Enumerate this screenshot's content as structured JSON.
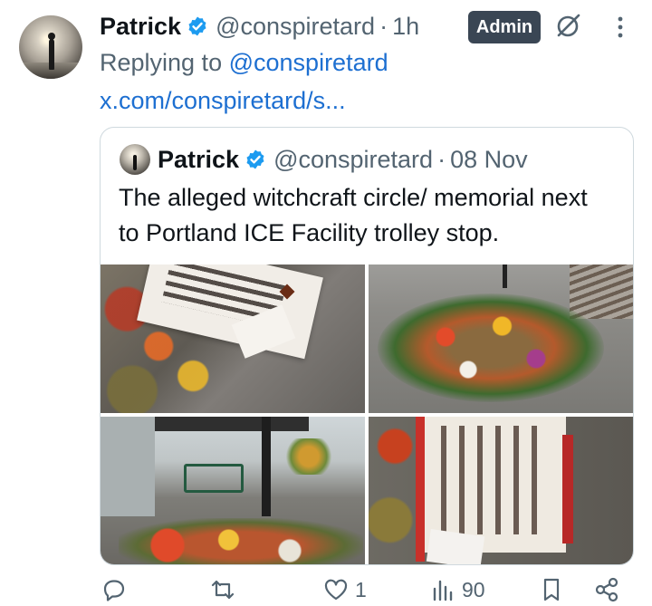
{
  "post": {
    "author_name": "Patrick",
    "handle": "@conspiretard",
    "separator": "·",
    "time": "1h",
    "admin_badge": "Admin",
    "replying_prefix": "Replying to",
    "replying_to": "@conspiretard",
    "link_text": "x.com/conspiretard/s..."
  },
  "quote": {
    "author_name": "Patrick",
    "handle": "@conspiretard",
    "separator": "·",
    "date": "08 Nov",
    "text": "The alleged witchcraft circle/ memorial next to Portland ICE Facility  trolley stop."
  },
  "actions": {
    "reply_count": "",
    "retweet_count": "",
    "like_count": "1",
    "views_count": "90"
  },
  "icons": {
    "verified": "verified-badge-icon",
    "grok": "grok-icon",
    "more": "more-options-icon",
    "reply": "reply-icon",
    "retweet": "retweet-icon",
    "like": "heart-icon",
    "views": "views-icon",
    "bookmark": "bookmark-icon",
    "share": "share-icon"
  },
  "colors": {
    "link": "#1d6fd1",
    "verified": "#1d9bf0",
    "admin_badge_bg": "#3a4654",
    "muted": "#536471"
  }
}
